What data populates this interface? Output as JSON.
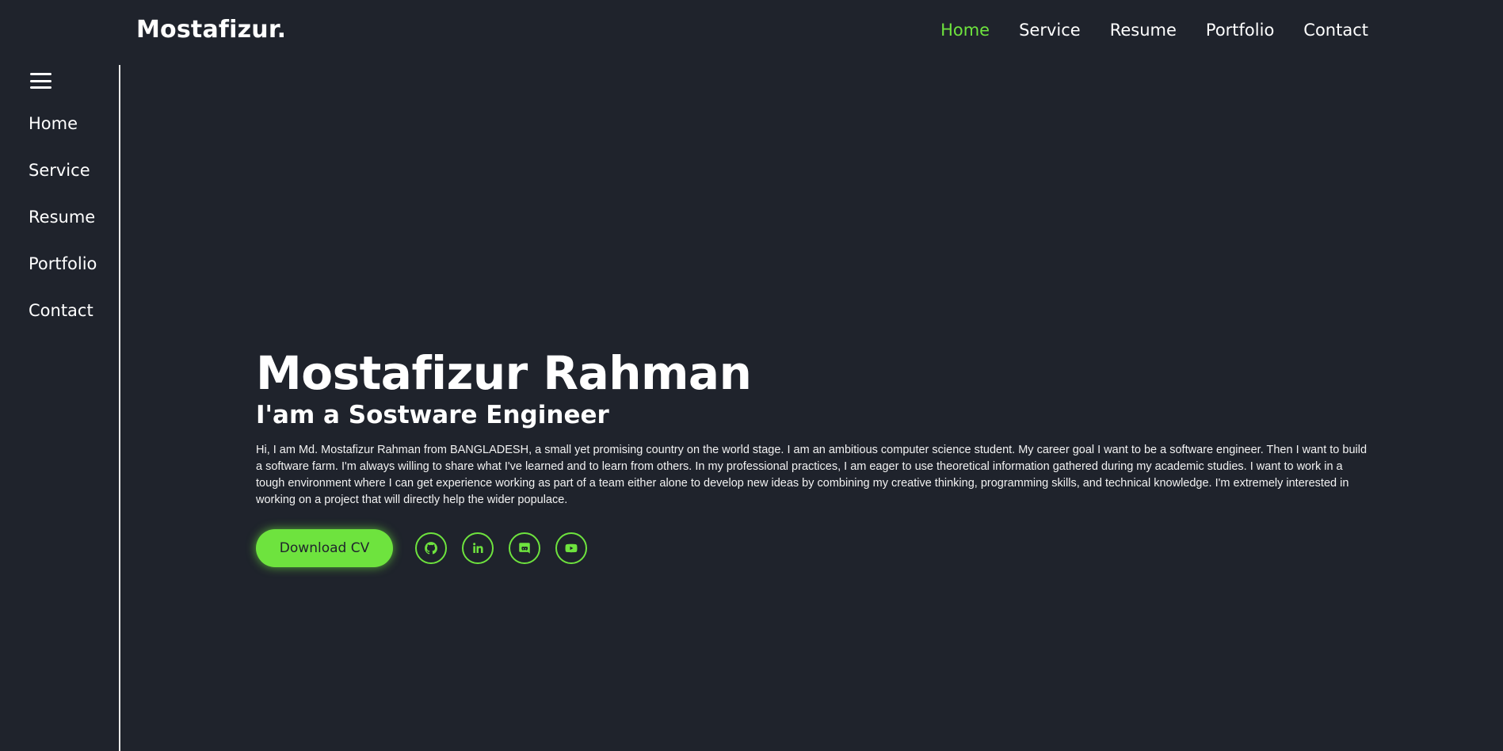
{
  "header": {
    "logo": "Mostafizur.",
    "nav": [
      "Home",
      "Service",
      "Resume",
      "Portfolio",
      "Contact"
    ],
    "active": "Home"
  },
  "sidebar": {
    "items": [
      "Home",
      "Service",
      "Resume",
      "Portfolio",
      "Contact"
    ]
  },
  "hero": {
    "name": "Mostafizur Rahman",
    "role": "I'am a Sostware Engineer",
    "bio": "Hi, I am Md. Mostafizur Rahman from BANGLADESH, a small yet promising country on the world stage. I am an ambitious computer science student. My career goal I want to be a software engineer. Then I want to build a software farm. I'm always willing to share what I've learned and to learn from others. In my professional practices, I am eager to use theoretical information gathered during my academic studies. I want to work in a tough environment where I can get experience working as part of a team either alone to develop new ideas by combining my creative thinking, programming skills, and technical knowledge. I'm extremely interested in working on a project that will directly help the wider populace.",
    "cv_label": "Download CV"
  },
  "socials": [
    "github-icon",
    "linkedin-icon",
    "discord-icon",
    "youtube-icon"
  ],
  "colors": {
    "background": "#1f232c",
    "accent": "#6ee33e",
    "text": "#ffffff"
  }
}
